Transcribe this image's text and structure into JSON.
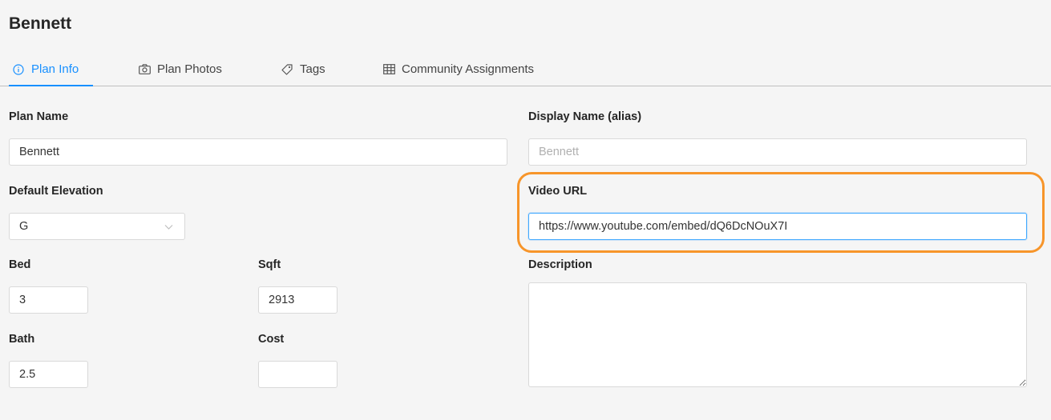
{
  "page": {
    "title": "Bennett"
  },
  "tabs": [
    {
      "label": "Plan Info",
      "icon": "info-circle-icon",
      "active": true
    },
    {
      "label": "Plan Photos",
      "icon": "camera-icon",
      "active": false
    },
    {
      "label": "Tags",
      "icon": "tag-icon",
      "active": false
    },
    {
      "label": "Community Assignments",
      "icon": "table-icon",
      "active": false
    }
  ],
  "form": {
    "plan_name": {
      "label": "Plan Name",
      "value": "Bennett"
    },
    "display_name": {
      "label": "Display Name (alias)",
      "value": "",
      "placeholder": "Bennett"
    },
    "default_elevation": {
      "label": "Default Elevation",
      "value": "G"
    },
    "video_url": {
      "label": "Video URL",
      "value": "https://www.youtube.com/embed/dQ6DcNOuX7I"
    },
    "bed": {
      "label": "Bed",
      "value": "3"
    },
    "sqft": {
      "label": "Sqft",
      "value": "2913"
    },
    "bath": {
      "label": "Bath",
      "value": "2.5"
    },
    "cost": {
      "label": "Cost",
      "value": ""
    },
    "description": {
      "label": "Description",
      "value": ""
    }
  },
  "colors": {
    "accent": "#1890ff",
    "highlight": "#f7952a",
    "background": "#f5f5f5"
  }
}
